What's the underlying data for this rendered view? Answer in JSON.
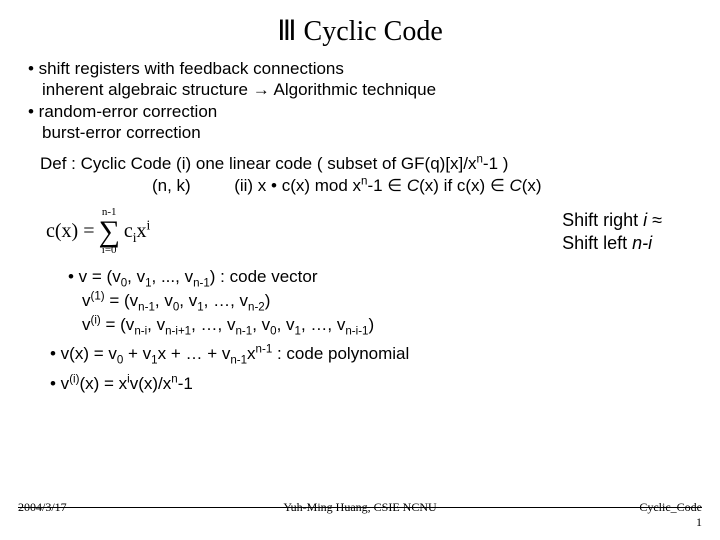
{
  "title": "Ⅲ Cyclic Code",
  "intro": {
    "l1": "• shift registers with feedback connections",
    "l2": "inherent algebraic structure → Algorithmic technique",
    "l3": "• random-error correction",
    "l4": "burst-error correction"
  },
  "def": {
    "l1a": "Def : Cyclic Code (i)  one linear code ( subset of GF(q)[x]/x",
    "l1b": "-1 )",
    "l2a": "(n, k)",
    "l2b": "(ii)  x • c(x) mod x",
    "l2c": "-1 ∈ ",
    "l2d": "(x)  if c(x) ∈ ",
    "l2e": "(x)",
    "Cital": "C"
  },
  "formula": {
    "lhs": "c(x)  =",
    "top": "n-1",
    "bot": "i=0",
    "rhs1": "c",
    "rhs2": "x"
  },
  "shift": {
    "l1a": "Shift right ",
    "l1b": "i",
    "l1c": " ≈",
    "l2a": "Shift left ",
    "l2b": "n-i"
  },
  "body": {
    "b1a": "• v = (v",
    "b1b": ", v",
    "b1c": ", ..., v",
    "b1d": ") : code vector",
    "b2a": "v",
    "b2b": " = (v",
    "b2c": ", v",
    "b2d": ", v",
    "b2e": ", …, v",
    "b2f": ")",
    "b3a": "v",
    "b3b": " = (v",
    "b3c": ", v",
    "b3d": ", …, v",
    "b3e": ", v",
    "b3f": ", v",
    "b3g": ", …, v",
    "b3h": ")",
    "b4a": "• v(x) = v",
    "b4b": " + v",
    "b4c": "x + … + v",
    "b4d": "x",
    "b4e": " : code polynomial",
    "b5a": "• v",
    "b5b": "(x) = x",
    "b5c": "v(x)/x",
    "b5d": "-1"
  },
  "sub": {
    "zero": "0",
    "one": "1",
    "nm1": "n-1",
    "nm2": "n-2",
    "nmi": "n-i",
    "nmip1": "n-i+1",
    "nmim1": "n-i-1",
    "i": "i",
    "n": "n"
  },
  "sup": {
    "one": "(1)",
    "i": "(i)",
    "ip": "i",
    "n": "n",
    "nm1": "n-1"
  },
  "footer": {
    "date": "2004/3/17",
    "author": "Yuh-Ming Huang, CSIE NCNU",
    "topic": "Cyclic_Code",
    "page": "1"
  }
}
